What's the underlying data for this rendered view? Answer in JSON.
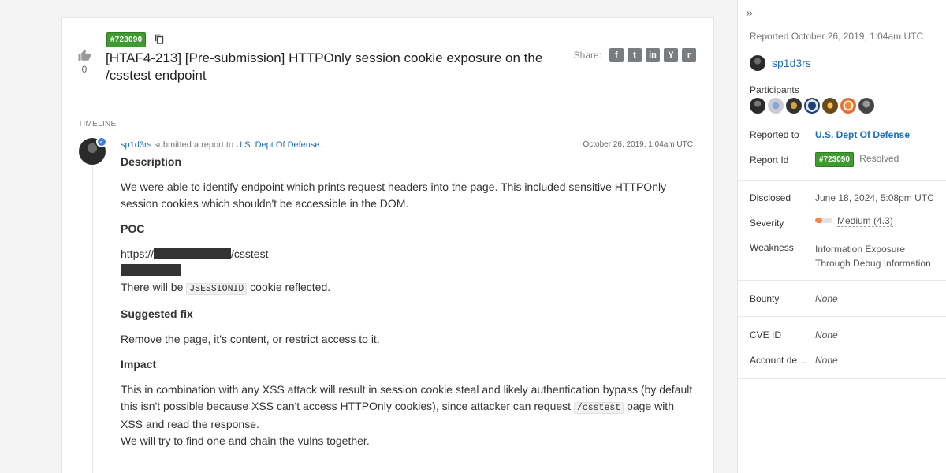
{
  "report": {
    "id_badge": "#723090",
    "title": "[HTAF4-213] [Pre-submission] HTTPOnly session cookie exposure on the /csstest endpoint",
    "vote_count": "0",
    "share_label": "Share:",
    "share_buttons": [
      {
        "icon": "facebook-icon",
        "glyph": "f"
      },
      {
        "icon": "twitter-icon",
        "glyph": "t"
      },
      {
        "icon": "linkedin-icon",
        "glyph": "in"
      },
      {
        "icon": "ycombinator-icon",
        "glyph": "Y"
      },
      {
        "icon": "reddit-icon",
        "glyph": "r"
      }
    ]
  },
  "timeline": {
    "label": "TIMELINE",
    "actor": "sp1d3rs",
    "action": "submitted a report to",
    "target": "U.S. Dept Of Defense",
    "period": ".",
    "time": "October 26, 2019, 1:04am UTC"
  },
  "content": {
    "h_description": "Description",
    "p_description": "We were able to identify endpoint which prints request headers into the page. This included sensitive HTTPOnly session cookies which shouldn't be accessible in the DOM.",
    "h_poc": "POC",
    "poc_url_prefix": "https://",
    "poc_url_suffix": "/csstest",
    "poc_line3_pre": "There will be",
    "poc_code": "JSESSIONID",
    "poc_line3_post": "cookie reflected.",
    "h_fix": "Suggested fix",
    "p_fix": "Remove the page, it's content, or restrict access to it.",
    "h_impact": "Impact",
    "p_impact_pre": "This in combination with any XSS attack will result in session cookie steal and likely authentication bypass (by default this isn't possible because XSS can't access HTTPOnly cookies), since attacker can request",
    "p_impact_code": "/csstest",
    "p_impact_post": "page with XSS and read the response.",
    "p_impact_last": "We will try to find one and chain the vulns together."
  },
  "sidebar": {
    "reported": "Reported October 26, 2019, 1:04am UTC",
    "reporter": "sp1d3rs",
    "participants_label": "Participants",
    "participant_count": 7,
    "reported_to_label": "Reported to",
    "reported_to": "U.S. Dept Of Defense",
    "report_id_label": "Report Id",
    "report_id": "#723090",
    "state": "Resolved",
    "disclosed_label": "Disclosed",
    "disclosed": "June 18, 2024, 5:08pm UTC",
    "severity_label": "Severity",
    "severity": "Medium (4.3)",
    "severity_score": 4.3,
    "severity_color": "#f0884a",
    "weakness_label": "Weakness",
    "weakness": "Information Exposure Through Debug Information",
    "bounty_label": "Bounty",
    "bounty": "None",
    "cve_label": "CVE ID",
    "cve": "None",
    "account_label": "Account de…",
    "account": "None"
  }
}
